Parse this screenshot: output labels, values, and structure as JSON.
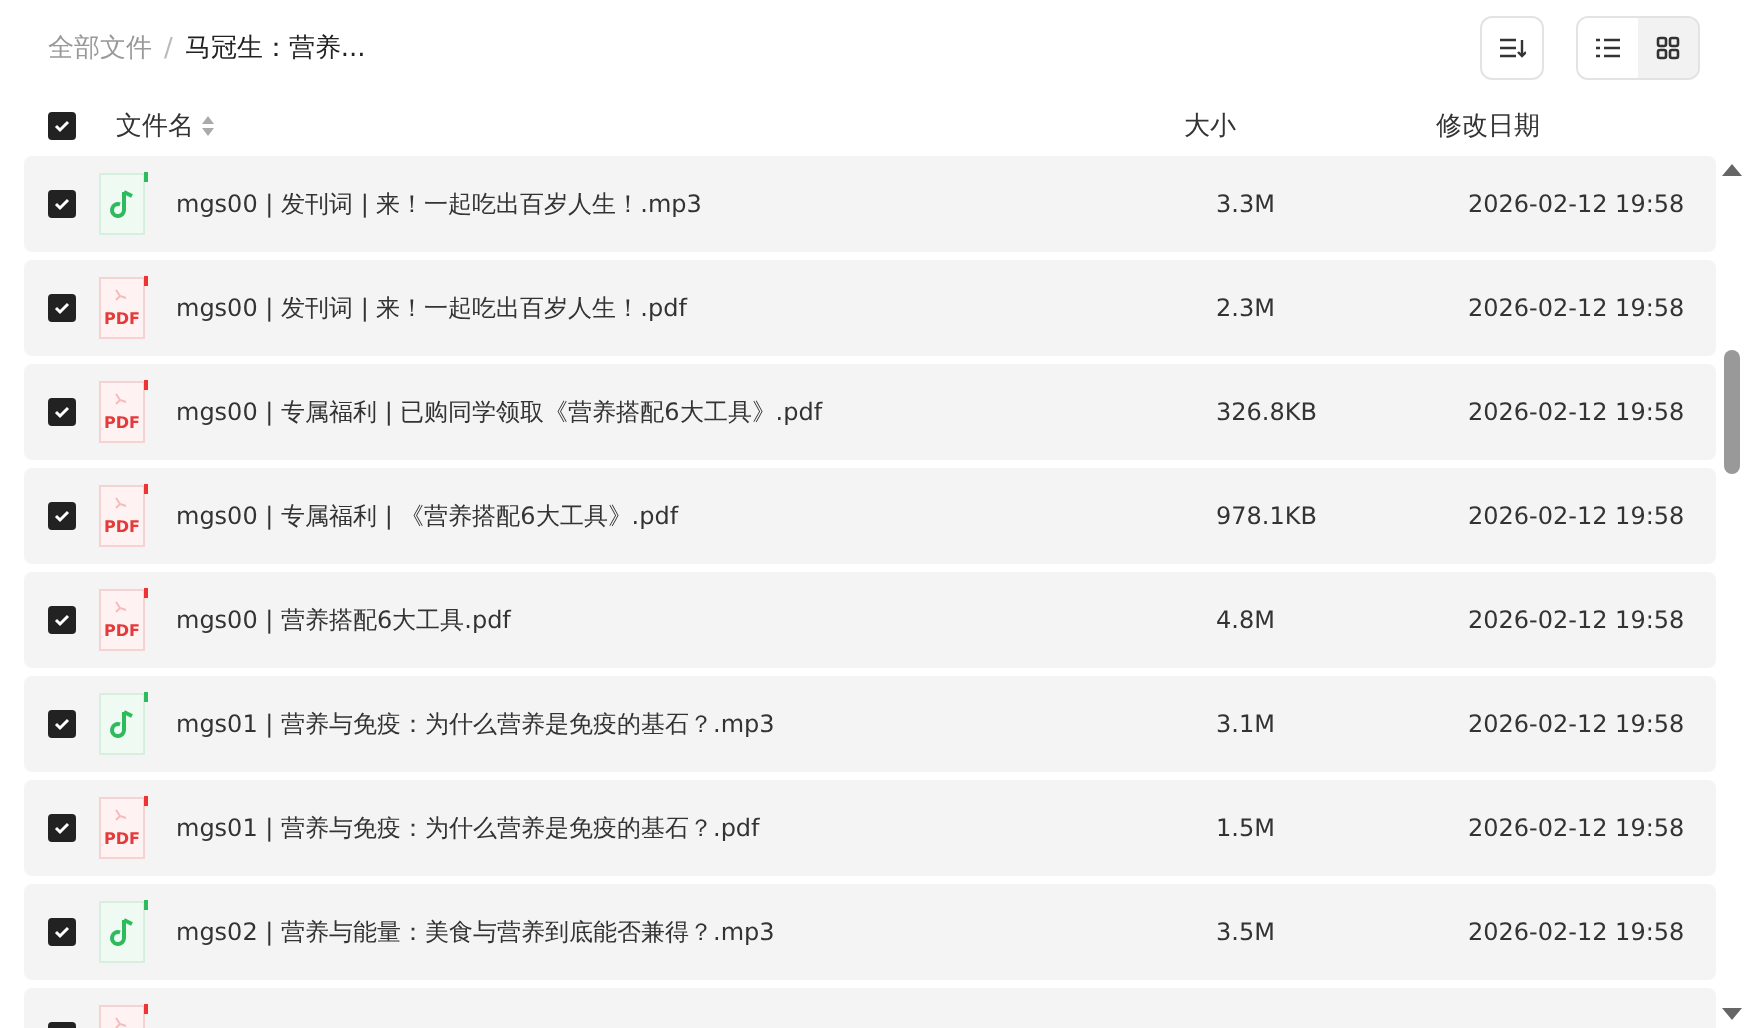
{
  "breadcrumb": [
    {
      "label": "全部文件",
      "current": false
    },
    {
      "label": "马冠生：营养...",
      "current": true
    }
  ],
  "breadcrumb_separator": "/",
  "view_toggle": [
    {
      "kind": "list",
      "selected": true
    },
    {
      "kind": "grid",
      "selected": false
    }
  ],
  "header": {
    "checked": true,
    "columns": [
      "文件名",
      "大小",
      "修改日期"
    ]
  },
  "rows": [
    {
      "kind": "audio",
      "checked": true,
      "name": "mgs00 | 发刊词 | 来！一起吃出百岁人生！.mp3",
      "size": "3.3M",
      "date": "2026-02-12 19:58"
    },
    {
      "kind": "pdf",
      "icon_label": "PDF",
      "checked": true,
      "name": "mgs00 | 发刊词 | 来！一起吃出百岁人生！.pdf",
      "size": "2.3M",
      "date": "2026-02-12 19:58"
    },
    {
      "kind": "pdf",
      "icon_label": "PDF",
      "checked": true,
      "name": "mgs00 | 专属福利 | 已购同学领取《营养搭配6大工具》.pdf",
      "size": "326.8KB",
      "date": "2026-02-12 19:58"
    },
    {
      "kind": "pdf",
      "icon_label": "PDF",
      "checked": true,
      "name": "mgs00 | 专属福利 | 《营养搭配6大工具》.pdf",
      "size": "978.1KB",
      "date": "2026-02-12 19:58"
    },
    {
      "kind": "pdf",
      "icon_label": "PDF",
      "checked": true,
      "name": "mgs00 | 营养搭配6大工具.pdf",
      "size": "4.8M",
      "date": "2026-02-12 19:58"
    },
    {
      "kind": "audio",
      "checked": true,
      "name": "mgs01 | 营养与免疫：为什么营养是免疫的基石？.mp3",
      "size": "3.1M",
      "date": "2026-02-12 19:58"
    },
    {
      "kind": "pdf",
      "icon_label": "PDF",
      "checked": true,
      "name": "mgs01 | 营养与免疫：为什么营养是免疫的基石？.pdf",
      "size": "1.5M",
      "date": "2026-02-12 19:58"
    },
    {
      "kind": "audio",
      "checked": true,
      "name": "mgs02 | 营养与能量：美食与营养到底能否兼得？.mp3",
      "size": "3.5M",
      "date": "2026-02-12 19:58"
    },
    {
      "kind": "pdf",
      "checked": true
    }
  ]
}
